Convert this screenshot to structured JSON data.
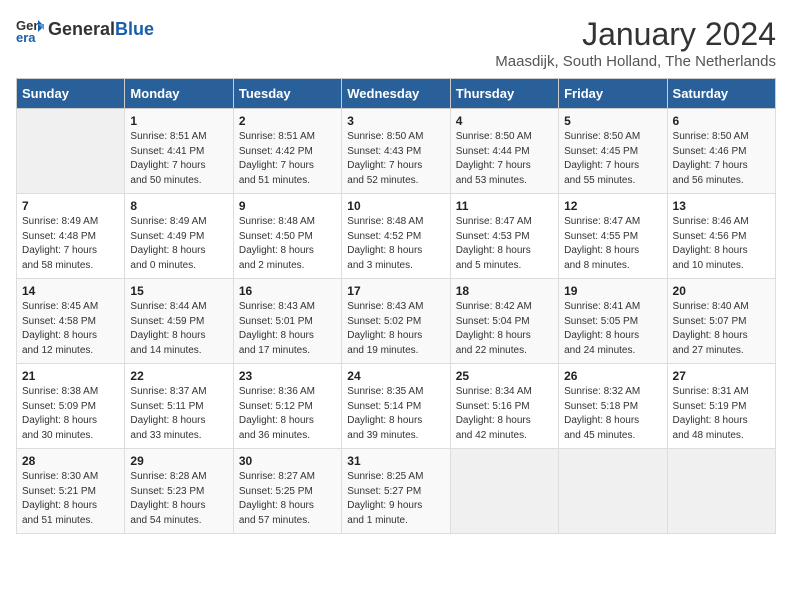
{
  "header": {
    "logo_general": "General",
    "logo_blue": "Blue",
    "title": "January 2024",
    "subtitle": "Maasdijk, South Holland, The Netherlands"
  },
  "weekdays": [
    "Sunday",
    "Monday",
    "Tuesday",
    "Wednesday",
    "Thursday",
    "Friday",
    "Saturday"
  ],
  "weeks": [
    [
      {
        "day": "",
        "info": ""
      },
      {
        "day": "1",
        "info": "Sunrise: 8:51 AM\nSunset: 4:41 PM\nDaylight: 7 hours\nand 50 minutes."
      },
      {
        "day": "2",
        "info": "Sunrise: 8:51 AM\nSunset: 4:42 PM\nDaylight: 7 hours\nand 51 minutes."
      },
      {
        "day": "3",
        "info": "Sunrise: 8:50 AM\nSunset: 4:43 PM\nDaylight: 7 hours\nand 52 minutes."
      },
      {
        "day": "4",
        "info": "Sunrise: 8:50 AM\nSunset: 4:44 PM\nDaylight: 7 hours\nand 53 minutes."
      },
      {
        "day": "5",
        "info": "Sunrise: 8:50 AM\nSunset: 4:45 PM\nDaylight: 7 hours\nand 55 minutes."
      },
      {
        "day": "6",
        "info": "Sunrise: 8:50 AM\nSunset: 4:46 PM\nDaylight: 7 hours\nand 56 minutes."
      }
    ],
    [
      {
        "day": "7",
        "info": "Sunrise: 8:49 AM\nSunset: 4:48 PM\nDaylight: 7 hours\nand 58 minutes."
      },
      {
        "day": "8",
        "info": "Sunrise: 8:49 AM\nSunset: 4:49 PM\nDaylight: 8 hours\nand 0 minutes."
      },
      {
        "day": "9",
        "info": "Sunrise: 8:48 AM\nSunset: 4:50 PM\nDaylight: 8 hours\nand 2 minutes."
      },
      {
        "day": "10",
        "info": "Sunrise: 8:48 AM\nSunset: 4:52 PM\nDaylight: 8 hours\nand 3 minutes."
      },
      {
        "day": "11",
        "info": "Sunrise: 8:47 AM\nSunset: 4:53 PM\nDaylight: 8 hours\nand 5 minutes."
      },
      {
        "day": "12",
        "info": "Sunrise: 8:47 AM\nSunset: 4:55 PM\nDaylight: 8 hours\nand 8 minutes."
      },
      {
        "day": "13",
        "info": "Sunrise: 8:46 AM\nSunset: 4:56 PM\nDaylight: 8 hours\nand 10 minutes."
      }
    ],
    [
      {
        "day": "14",
        "info": "Sunrise: 8:45 AM\nSunset: 4:58 PM\nDaylight: 8 hours\nand 12 minutes."
      },
      {
        "day": "15",
        "info": "Sunrise: 8:44 AM\nSunset: 4:59 PM\nDaylight: 8 hours\nand 14 minutes."
      },
      {
        "day": "16",
        "info": "Sunrise: 8:43 AM\nSunset: 5:01 PM\nDaylight: 8 hours\nand 17 minutes."
      },
      {
        "day": "17",
        "info": "Sunrise: 8:43 AM\nSunset: 5:02 PM\nDaylight: 8 hours\nand 19 minutes."
      },
      {
        "day": "18",
        "info": "Sunrise: 8:42 AM\nSunset: 5:04 PM\nDaylight: 8 hours\nand 22 minutes."
      },
      {
        "day": "19",
        "info": "Sunrise: 8:41 AM\nSunset: 5:05 PM\nDaylight: 8 hours\nand 24 minutes."
      },
      {
        "day": "20",
        "info": "Sunrise: 8:40 AM\nSunset: 5:07 PM\nDaylight: 8 hours\nand 27 minutes."
      }
    ],
    [
      {
        "day": "21",
        "info": "Sunrise: 8:38 AM\nSunset: 5:09 PM\nDaylight: 8 hours\nand 30 minutes."
      },
      {
        "day": "22",
        "info": "Sunrise: 8:37 AM\nSunset: 5:11 PM\nDaylight: 8 hours\nand 33 minutes."
      },
      {
        "day": "23",
        "info": "Sunrise: 8:36 AM\nSunset: 5:12 PM\nDaylight: 8 hours\nand 36 minutes."
      },
      {
        "day": "24",
        "info": "Sunrise: 8:35 AM\nSunset: 5:14 PM\nDaylight: 8 hours\nand 39 minutes."
      },
      {
        "day": "25",
        "info": "Sunrise: 8:34 AM\nSunset: 5:16 PM\nDaylight: 8 hours\nand 42 minutes."
      },
      {
        "day": "26",
        "info": "Sunrise: 8:32 AM\nSunset: 5:18 PM\nDaylight: 8 hours\nand 45 minutes."
      },
      {
        "day": "27",
        "info": "Sunrise: 8:31 AM\nSunset: 5:19 PM\nDaylight: 8 hours\nand 48 minutes."
      }
    ],
    [
      {
        "day": "28",
        "info": "Sunrise: 8:30 AM\nSunset: 5:21 PM\nDaylight: 8 hours\nand 51 minutes."
      },
      {
        "day": "29",
        "info": "Sunrise: 8:28 AM\nSunset: 5:23 PM\nDaylight: 8 hours\nand 54 minutes."
      },
      {
        "day": "30",
        "info": "Sunrise: 8:27 AM\nSunset: 5:25 PM\nDaylight: 8 hours\nand 57 minutes."
      },
      {
        "day": "31",
        "info": "Sunrise: 8:25 AM\nSunset: 5:27 PM\nDaylight: 9 hours\nand 1 minute."
      },
      {
        "day": "",
        "info": ""
      },
      {
        "day": "",
        "info": ""
      },
      {
        "day": "",
        "info": ""
      }
    ]
  ]
}
